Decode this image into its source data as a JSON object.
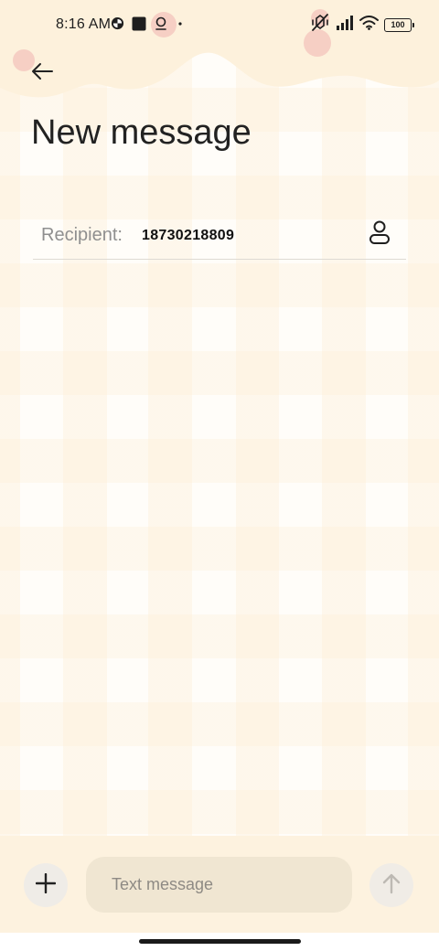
{
  "status_bar": {
    "time": "8:16 AM",
    "left_icons": [
      "notification-app-icon",
      "notification-square-icon",
      "notification-location-icon",
      "more-notifications-dot"
    ],
    "right_icons": [
      "vibrate-off-icon",
      "signal-icon",
      "wifi-icon",
      "battery-icon"
    ],
    "battery_level": "100"
  },
  "header": {
    "back_icon": "arrow-left-icon",
    "title": "New message"
  },
  "recipient": {
    "label": "Recipient:",
    "value": "18730218809",
    "contact_icon": "person-icon"
  },
  "compose": {
    "attach_icon": "plus-icon",
    "placeholder": "Text message",
    "value": "",
    "send_icon": "arrow-up-icon"
  },
  "theme": {
    "banner_color": "#fdf1dc",
    "bubble_color": "#f6cfc4",
    "compose_bar_color": "#fdf2df",
    "input_color": "#f0e6d2"
  }
}
